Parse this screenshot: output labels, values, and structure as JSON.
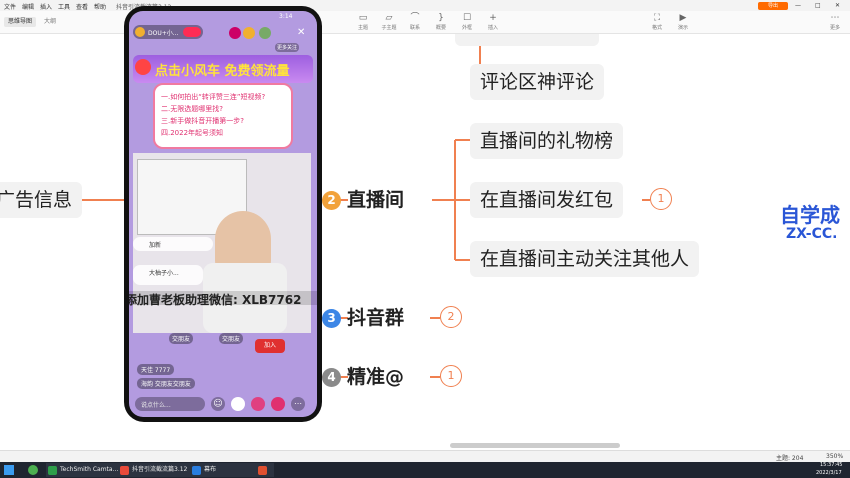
{
  "menubar": {
    "items": [
      "文件",
      "编辑",
      "插入",
      "工具",
      "查看",
      "帮助"
    ],
    "title": "抖音引流截流篇3.12"
  },
  "tabs": {
    "active": "思维导图",
    "outline": "大纲"
  },
  "toolbar": {
    "tools": [
      "主题",
      "子主题",
      "联系",
      "概要",
      "外框",
      "插入"
    ],
    "right_tools": [
      "格式",
      "演示",
      "更多"
    ],
    "export_label": "导出"
  },
  "mindmap": {
    "left_node": "广告信息",
    "main_nodes": [
      {
        "num": "2",
        "label": "直播间",
        "color": "#f2a23a"
      },
      {
        "num": "3",
        "label": "抖音群",
        "color": "#3c86e6"
      },
      {
        "num": "4",
        "label": "精准@",
        "color": "#8a8a8a"
      }
    ],
    "sub_nodes": {
      "comment": "评论区神评论",
      "gift": "直播间的礼物榜",
      "redpacket": "在直播间发红包",
      "follow": "在直播间主动关注其他人"
    },
    "badges": {
      "redpacket": "1",
      "group": "2",
      "at": "1"
    }
  },
  "watermark": {
    "line1": "自学成",
    "line2": "ZX-CC."
  },
  "phone": {
    "time": "3:14",
    "host": "DOU+小...",
    "follow_tag": "更多关注",
    "banner": "点击小风车 免费领流量",
    "questions": [
      "一.如何拍出“转评赞三连”短视频?",
      "二.无限选题哪里找?",
      "三.新手做抖音开播第一步?",
      "四.2022年起号须知"
    ],
    "overlay": "添加曹老板助理微信: XLB7762",
    "chat": [
      "加新",
      "大柚子小...",
      "交朋友",
      "交朋友",
      "天佳 7777",
      "海韵 交朋友交朋友"
    ],
    "input_placeholder": "说点什么...",
    "join_btn": "加入"
  },
  "status": {
    "topics": "主题: 204",
    "zoom": "350%"
  },
  "taskbar": {
    "apps": [
      "TechSmith Camta...",
      "抖音引流截流篇3.12",
      "幕布",
      ""
    ],
    "time": "15:37:45",
    "date": "2022/3/17"
  },
  "colors": {
    "branch": "#f08050",
    "accent": "#ff6a00"
  }
}
